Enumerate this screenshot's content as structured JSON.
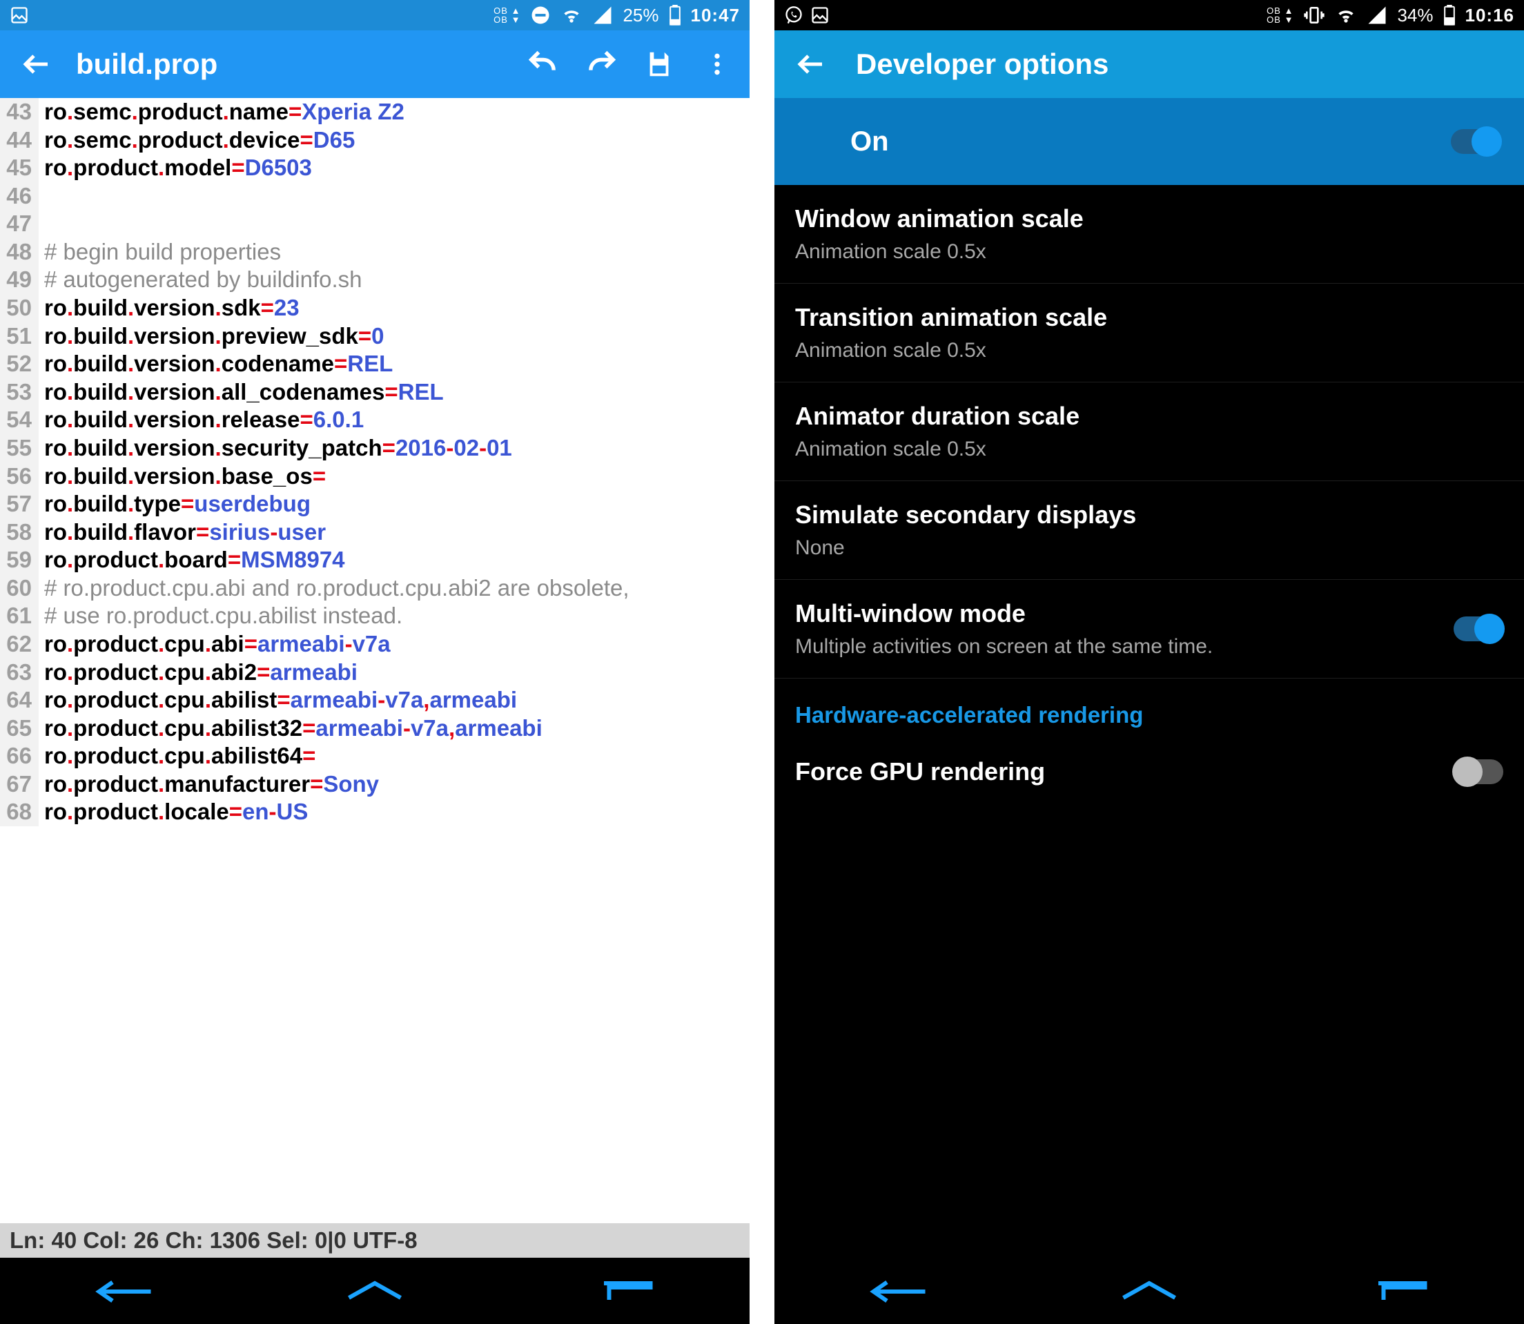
{
  "left": {
    "statusbar": {
      "ob": "OB",
      "battery": "25%",
      "time": "10:47"
    },
    "appbar": {
      "title": "build.prop"
    },
    "lines": [
      {
        "n": "43",
        "key": "ro.semc.product.name",
        "val": "Xperia Z2"
      },
      {
        "n": "44",
        "key": "ro.semc.product.device",
        "val": "D65"
      },
      {
        "n": "45",
        "key": "ro.product.model",
        "val": "D6503"
      },
      {
        "n": "46"
      },
      {
        "n": "47"
      },
      {
        "n": "48",
        "comment": "# begin build properties"
      },
      {
        "n": "49",
        "comment": "# autogenerated by buildinfo.sh"
      },
      {
        "n": "50",
        "key": "ro.build.version.sdk",
        "val": "23"
      },
      {
        "n": "51",
        "key": "ro.build.version.preview_sdk",
        "val": "0"
      },
      {
        "n": "52",
        "key": "ro.build.version.codename",
        "val": "REL"
      },
      {
        "n": "53",
        "key": "ro.build.version.all_codenames",
        "val": "REL"
      },
      {
        "n": "54",
        "key": "ro.build.version.release",
        "val": "6.0.1"
      },
      {
        "n": "55",
        "key": "ro.build.version.security_patch",
        "val": "2016-02-01"
      },
      {
        "n": "56",
        "key": "ro.build.version.base_os",
        "val": ""
      },
      {
        "n": "57",
        "key": "ro.build.type",
        "val": "userdebug"
      },
      {
        "n": "58",
        "key": "ro.build.flavor",
        "val": "sirius-user"
      },
      {
        "n": "59",
        "key": "ro.product.board",
        "val": "MSM8974"
      },
      {
        "n": "60",
        "comment": "# ro.product.cpu.abi and ro.product.cpu.abi2 are obsolete,"
      },
      {
        "n": "61",
        "comment": "# use ro.product.cpu.abilist instead."
      },
      {
        "n": "62",
        "key": "ro.product.cpu.abi",
        "val": "armeabi-v7a"
      },
      {
        "n": "63",
        "key": "ro.product.cpu.abi2",
        "val": "armeabi"
      },
      {
        "n": "64",
        "key": "ro.product.cpu.abilist",
        "val": "armeabi-v7a,armeabi"
      },
      {
        "n": "65",
        "key": "ro.product.cpu.abilist32",
        "val": "armeabi-v7a,armeabi"
      },
      {
        "n": "66",
        "key": "ro.product.cpu.abilist64",
        "val": ""
      },
      {
        "n": "67",
        "key": "ro.product.manufacturer",
        "val": "Sony"
      },
      {
        "n": "68",
        "key": "ro.product.locale",
        "val": "en-US"
      }
    ],
    "status": "Ln: 40  Col: 26  Ch: 1306  Sel: 0|0   UTF-8"
  },
  "right": {
    "statusbar": {
      "ob": "OB",
      "battery": "34%",
      "time": "10:16"
    },
    "appbar": {
      "title": "Developer options"
    },
    "on_label": "On",
    "rows": [
      {
        "title": "Window animation scale",
        "sub": "Animation scale 0.5x"
      },
      {
        "title": "Transition animation scale",
        "sub": "Animation scale 0.5x"
      },
      {
        "title": "Animator duration scale",
        "sub": "Animation scale 0.5x"
      },
      {
        "title": "Simulate secondary displays",
        "sub": "None"
      },
      {
        "title": "Multi-window mode",
        "sub": "Multiple activities on screen at the same time.",
        "toggle": "on"
      }
    ],
    "section": "Hardware-accelerated rendering",
    "last_row": {
      "title": "Force GPU rendering",
      "toggle": "off"
    }
  }
}
